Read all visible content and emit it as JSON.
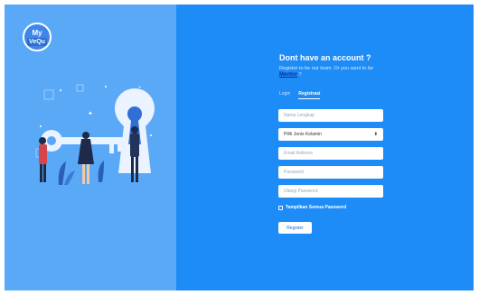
{
  "brand": {
    "line1": "My",
    "line2": "VeQu"
  },
  "heading": {
    "title": "Dont have an account ?",
    "subtitle": "Register to be our team. Or you want to be",
    "mentor_link": "Mentor",
    "mentor_suffix": "?"
  },
  "tabs": [
    {
      "label": "Login",
      "active": false
    },
    {
      "label": "Registrasi",
      "active": true
    }
  ],
  "form": {
    "name_placeholder": "Nama Lengkap",
    "gender_selected": "Pilih Jenis Kelamin",
    "email_placeholder": "Email Address",
    "password_placeholder": "Password",
    "repeat_password_placeholder": "Ulangi Password",
    "show_password_label": "Tampilkan Semua Password",
    "submit_label": "Register"
  },
  "icons": {
    "select": "chevron-updown-icon",
    "illustration": "people-with-key-illustration"
  },
  "colors": {
    "left_panel": "#5aa9f7",
    "right_panel": "#1e8cf6",
    "link": "#0a2f9c"
  }
}
